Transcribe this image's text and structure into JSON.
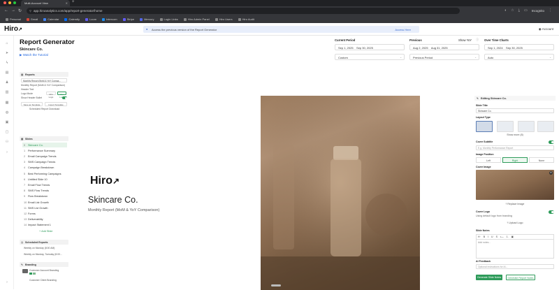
{
  "browser": {
    "tab_title": "Multi-Account View",
    "new_tab": "+",
    "url": "app.hiroanalytics.com/app/report-generator/home",
    "incognito": "Incognito",
    "bookmarks": [
      {
        "label": "Personal",
        "color": "#888888"
      },
      {
        "label": "Gmail",
        "color": "#d44638"
      },
      {
        "label": "Calendar",
        "color": "#4285f4"
      },
      {
        "label": "Calendly",
        "color": "#006bff"
      },
      {
        "label": "Loom",
        "color": "#625df5"
      },
      {
        "label": "Intercom",
        "color": "#1f8ded"
      },
      {
        "label": "Stripe",
        "color": "#635bff"
      },
      {
        "label": "Mercury",
        "color": "#5266eb"
      },
      {
        "label": "Login Links",
        "color": "#888888"
      },
      {
        "label": "Hiro Admin Panel",
        "color": "#888888"
      },
      {
        "label": "Hiro Users",
        "color": "#888888"
      },
      {
        "label": "Hiro Audit",
        "color": "#888888"
      }
    ]
  },
  "app": {
    "logo": "Hiro",
    "banner_text": "Access the previous version of the Report Generator",
    "banner_link": "Access Here",
    "account": "Account"
  },
  "header": {
    "title": "Report Generator",
    "company": "Skincare Co.",
    "tutorial": "Watch the Tutorial"
  },
  "periods": {
    "current_label": "Current Period",
    "current_start": "Sep 1, 2025",
    "current_end": "Sep 30, 2025",
    "current_select": "Custom",
    "previous_label": "Previous",
    "previous_start": "Aug 2, 2025",
    "previous_end": "Aug 31, 2025",
    "previous_select": "Previous Period",
    "show_yoy": "Show YoY",
    "over_time_label": "Over Time Charts",
    "over_time_start": "Sep 1, 2024",
    "over_time_end": "Sep 30, 2025",
    "over_time_select": "Auto"
  },
  "left": {
    "reports_label": "Reports",
    "report_name": "Monthly Report (MoM & YoY Compa...",
    "report_sub": "Monthly Report (MoM & YoY Comparison)",
    "header_text": "Header Text",
    "logo_label": "Logo Mode",
    "logo_value": "Hiro Logo",
    "show_header": "Show Header Bullet",
    "save_template": "Save as Template",
    "import_template": "Import Template",
    "schedule": "Scheduled Report Download",
    "slides_label": "Slides",
    "slides": [
      {
        "num": "0",
        "label": "Skincare Co."
      },
      {
        "num": "1",
        "label": "Performance Summary"
      },
      {
        "num": "2",
        "label": "Email Campaign Trends"
      },
      {
        "num": "3",
        "label": "SMS Campaign Trends"
      },
      {
        "num": "4",
        "label": "Campaign Breakdown"
      },
      {
        "num": "5",
        "label": "Best Performing Campaigns"
      },
      {
        "num": "6",
        "label": "Untitled Slide 10"
      },
      {
        "num": "7",
        "label": "Email Flow Trends"
      },
      {
        "num": "8",
        "label": "SMS Flow Trends"
      },
      {
        "num": "9",
        "label": "Flow Breakdown"
      },
      {
        "num": "10",
        "label": "Email List Growth"
      },
      {
        "num": "11",
        "label": "SMS List Growth"
      },
      {
        "num": "12",
        "label": "Forms"
      },
      {
        "num": "13",
        "label": "Deliverability"
      },
      {
        "num": "14",
        "label": "Impact Statement 1"
      }
    ],
    "add_slide": "+ Add Slide",
    "scheduled_label": "Scheduled Exports",
    "scheduled_items": [
      "Weekly on Monday (8:00 AM)",
      "Weekly on Monday, Tuesday (8:00..."
    ],
    "branding_label": "Branding",
    "branding_items": [
      "Customer Account Branding",
      "Customer Client Branding"
    ]
  },
  "slide": {
    "logo": "Hiro",
    "title": "Skincare Co.",
    "subtitle": "Monthly Report (MoM & YoY Comparison)"
  },
  "right": {
    "editing": "Editing Skincare Co.",
    "slide_title_label": "Slide Title",
    "slide_title_value": "Skincare Co.",
    "layout_label": "Layout Type",
    "show_more": "Show more (8)",
    "cover_subtitle_label": "Cover Subtitle",
    "cover_subtitle_value": "E.g. Monthly Performance Report",
    "image_position_label": "Image Position",
    "positions": [
      "Left",
      "Right",
      "None"
    ],
    "cover_image_label": "Cover Image",
    "replace_image": "Replace Image",
    "cover_logo_label": "Cover Logo",
    "cover_logo_sub": "Using default logo from branding",
    "upload_logo": "Upload Logo",
    "notes_label": "Slide Notes",
    "toolbar": [
      "H·",
      "B",
      "I",
      "U",
      "S",
      "•—",
      "1.",
      "▣"
    ],
    "notes_placeholder": "Add notes...",
    "ai_label": "AI Feedback",
    "ai_placeholder": "Optional instructions for AI...",
    "generate_notes": "Generate Slide Notes",
    "regenerate": "Generate Report Notes"
  }
}
